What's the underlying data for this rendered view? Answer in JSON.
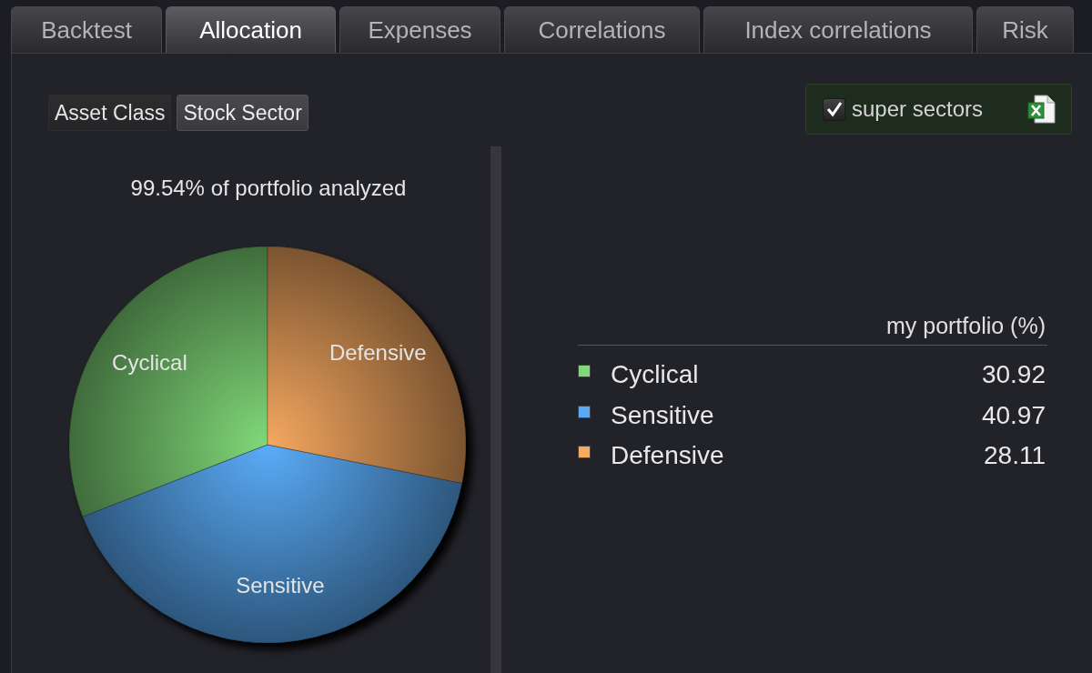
{
  "tabs": [
    {
      "label": "Backtest",
      "selected": false
    },
    {
      "label": "Allocation",
      "selected": true
    },
    {
      "label": "Expenses",
      "selected": false
    },
    {
      "label": "Correlations",
      "selected": false
    },
    {
      "label": "Index correlations",
      "selected": false
    },
    {
      "label": "Risk",
      "selected": false
    }
  ],
  "view_buttons": [
    {
      "label": "Asset Class",
      "selected": false
    },
    {
      "label": "Stock Sector",
      "selected": true
    }
  ],
  "super_sectors": {
    "label": "super sectors",
    "checked": true
  },
  "allocation": {
    "caption": "99.54% of portfolio analyzed",
    "chart_data": {
      "type": "pie",
      "categories": [
        "Cyclical",
        "Sensitive",
        "Defensive"
      ],
      "values": [
        30.92,
        40.97,
        28.11
      ],
      "colors": [
        "#80d878",
        "#5aacf8",
        "#f5a860"
      ]
    }
  },
  "table": {
    "columns": [
      "my portfolio (%)"
    ],
    "rows": [
      {
        "name": "Cyclical",
        "value": "30.92",
        "color": "#7fd97a"
      },
      {
        "name": "Sensitive",
        "value": "40.97",
        "color": "#58aaf5"
      },
      {
        "name": "Defensive",
        "value": "28.11",
        "color": "#f6aa62"
      }
    ]
  }
}
